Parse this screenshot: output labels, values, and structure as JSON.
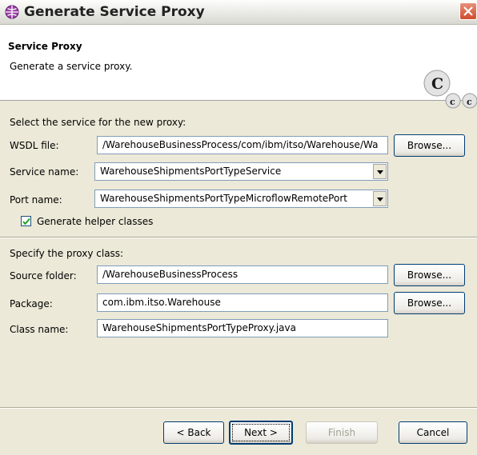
{
  "window": {
    "title": "Generate Service Proxy"
  },
  "banner": {
    "title": "Service Proxy",
    "description": "Generate a service proxy."
  },
  "service_section": {
    "heading": "Select the service for the new proxy:",
    "wsdl_label": "WSDL file:",
    "wsdl_value": "/WarehouseBusinessProcess/com/ibm/itso/Warehouse/Wa",
    "browse_label": "Browse...",
    "service_label": "Service name:",
    "service_value": "WarehouseShipmentsPortTypeService",
    "port_label": "Port name:",
    "port_value": "WarehouseShipmentsPortTypeMicroflowRemotePort",
    "helper_label": "Generate helper classes",
    "helper_checked": true
  },
  "proxy_section": {
    "heading": "Specify the proxy class:",
    "source_label": "Source folder:",
    "source_value": "/WarehouseBusinessProcess",
    "package_label": "Package:",
    "package_value": "com.ibm.itso.Warehouse",
    "class_label": "Class name:",
    "class_value": "WarehouseShipmentsPortTypeProxy.java",
    "browse_label": "Browse..."
  },
  "buttons": {
    "back": "< Back",
    "next": "Next >",
    "finish": "Finish",
    "cancel": "Cancel"
  },
  "icons": {
    "title": "globe-icon",
    "close": "close-icon",
    "banner": "class-c-icon"
  },
  "colors": {
    "title_close": "#d2573b",
    "field_border": "#7f9db9",
    "button_border": "#003c74"
  }
}
